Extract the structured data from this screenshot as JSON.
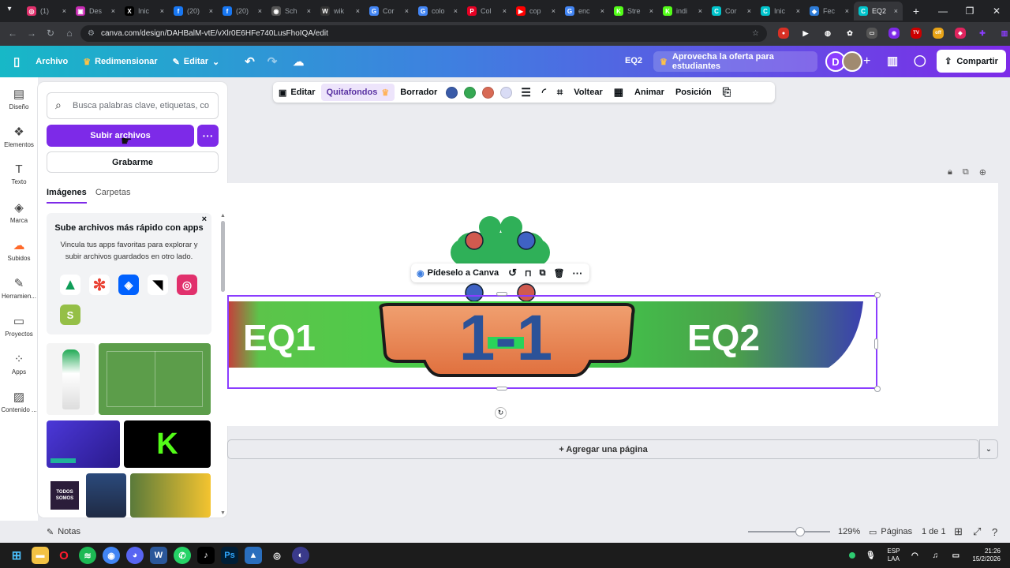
{
  "browser": {
    "tabs": [
      {
        "label": "(1)",
        "color": "#e1306c",
        "glyph": "◎"
      },
      {
        "label": "Des",
        "color": "#c62ab2",
        "glyph": "▣"
      },
      {
        "label": "Inic",
        "color": "#000000",
        "glyph": "X"
      },
      {
        "label": "(20)",
        "color": "#1877f2",
        "glyph": "f"
      },
      {
        "label": "(20)",
        "color": "#1877f2",
        "glyph": "f"
      },
      {
        "label": "Sch",
        "color": "#555555",
        "glyph": "◉"
      },
      {
        "label": "wik",
        "color": "#333333",
        "glyph": "W"
      },
      {
        "label": "Cor",
        "color": "#4285f4",
        "glyph": "G"
      },
      {
        "label": "colo",
        "color": "#4285f4",
        "glyph": "G"
      },
      {
        "label": "Col",
        "color": "#e60023",
        "glyph": "P"
      },
      {
        "label": "cop",
        "color": "#ff0000",
        "glyph": "▶"
      },
      {
        "label": "enc",
        "color": "#4285f4",
        "glyph": "G"
      },
      {
        "label": "Stre",
        "color": "#53fc18",
        "glyph": "K"
      },
      {
        "label": "indi",
        "color": "#53fc18",
        "glyph": "K"
      },
      {
        "label": "Cor",
        "color": "#00c4cc",
        "glyph": "C"
      },
      {
        "label": "Inic",
        "color": "#00c4cc",
        "glyph": "C"
      },
      {
        "label": "Fec",
        "color": "#2d7bd7",
        "glyph": "◆"
      },
      {
        "label": "EQ2",
        "color": "#00c4cc",
        "glyph": "C"
      }
    ],
    "url": "canva.com/design/DAHBalM-vtE/vXlr0E6HFe740LusFhoIQA/edit"
  },
  "header": {
    "archivo": "Archivo",
    "redimensionar": "Redimensionar",
    "editar": "Editar",
    "doc_title": "EQ2",
    "promo": "Aprovecha la oferta para estudiantes",
    "avatar_letter": "D",
    "share": "Compartir"
  },
  "rail": [
    {
      "label": "Diseño",
      "icon": "layout-icon",
      "glyph": "▤"
    },
    {
      "label": "Elementos",
      "icon": "shapes-icon",
      "glyph": "❖"
    },
    {
      "label": "Texto",
      "icon": "text-icon",
      "glyph": "T"
    },
    {
      "label": "Marca",
      "icon": "brand-icon",
      "glyph": "◈"
    },
    {
      "label": "Subidos",
      "icon": "upload-cloud-icon",
      "glyph": "☁"
    },
    {
      "label": "Herramien...",
      "icon": "tools-icon",
      "glyph": "✎"
    },
    {
      "label": "Proyectos",
      "icon": "folder-icon",
      "glyph": "▭"
    },
    {
      "label": "Apps",
      "icon": "apps-icon",
      "glyph": "⁘"
    },
    {
      "label": "Contenido ...",
      "icon": "media-icon",
      "glyph": "▨"
    }
  ],
  "panel": {
    "search_placeholder": "Busca palabras clave, etiquetas, co",
    "upload_label": "Subir archivos",
    "record_label": "Grabarme",
    "tab_images": "Imágenes",
    "tab_folders": "Carpetas",
    "card_title": "Sube archivos más rápido con apps",
    "card_text": "Vincula tus apps favoritas para explorar y subir archivos guardados en otro lado.",
    "thumb_text_1": "TODOS\nSOMOS",
    "thumb_text_2": "K"
  },
  "toolbar": {
    "editar": "Editar",
    "quitafondos": "Quitafondos",
    "borrador": "Borrador",
    "colors": [
      "#3a5ba8",
      "#35a853",
      "#d86a55",
      "#d9dcf5"
    ],
    "voltear": "Voltear",
    "animar": "Animar",
    "posicion": "Posición"
  },
  "canvas": {
    "team1": "EQ1",
    "team2": "EQ2",
    "score": "1-1",
    "ask_canva": "Pídeselo a Canva",
    "add_page": "+ Agregar una página"
  },
  "footer": {
    "notes": "Notas",
    "zoom": "129%",
    "zoom_level": 0.5,
    "pages_label": "Páginas",
    "page_count": "1 de 1"
  },
  "taskbar": {
    "lang1": "ESP",
    "lang2": "LAA",
    "time": "21:26",
    "date": "15/2/2026"
  }
}
